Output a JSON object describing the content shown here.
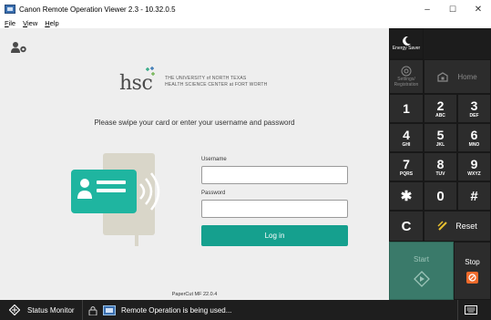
{
  "window": {
    "title": "Canon Remote Operation Viewer 2.3 - 10.32.0.5",
    "minimize": "–",
    "maximize": "☐",
    "close": "✕"
  },
  "menu": {
    "file": {
      "underline": "F",
      "rest": "ile"
    },
    "view": {
      "underline": "V",
      "rest": "iew"
    },
    "help": {
      "underline": "H",
      "rest": "elp"
    }
  },
  "login": {
    "logo_hsc": "hsc",
    "logo_line1": "THE UNIVERSITY of NORTH TEXAS",
    "logo_line2": "HEALTH SCIENCE CENTER at FORT WORTH",
    "prompt": "Please swipe your card or enter your username and password",
    "username_label": "Username",
    "username_value": "",
    "password_label": "Password",
    "password_value": "",
    "login_button": "Log in",
    "version": "PaperCut MF 22.0.4"
  },
  "panel": {
    "energy_saver": "Energy Saver",
    "settings_registration": "Settings/ Registration",
    "home": "Home",
    "keys": [
      {
        "num": "1",
        "sub": ""
      },
      {
        "num": "2",
        "sub": "ABC"
      },
      {
        "num": "3",
        "sub": "DEF"
      },
      {
        "num": "4",
        "sub": "GHI"
      },
      {
        "num": "5",
        "sub": "JKL"
      },
      {
        "num": "6",
        "sub": "MNO"
      },
      {
        "num": "7",
        "sub": "PQRS"
      },
      {
        "num": "8",
        "sub": "TUV"
      },
      {
        "num": "9",
        "sub": "WXYZ"
      }
    ],
    "star": "✱",
    "zero": "0",
    "hash": "#",
    "clear": "C",
    "reset": "Reset",
    "start": "Start",
    "stop": "Stop"
  },
  "taskbar": {
    "status_monitor": "Status Monitor",
    "remote_status": "Remote Operation is being used..."
  },
  "colors": {
    "accent_teal": "#15a08e",
    "start_green": "#3a7a6a",
    "stop_orange": "#f06a2a"
  }
}
